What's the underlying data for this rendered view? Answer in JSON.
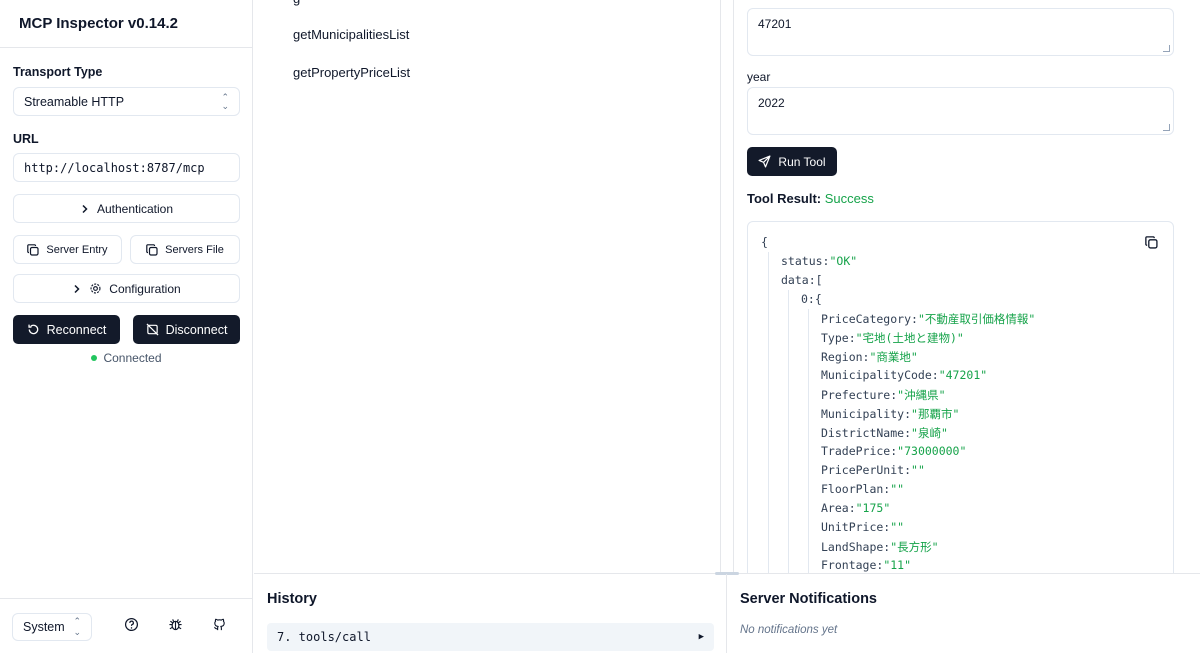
{
  "app": {
    "title": "MCP Inspector v0.14.2"
  },
  "sidebar": {
    "transport_label": "Transport Type",
    "transport_value": "Streamable HTTP",
    "url_label": "URL",
    "url_value": "http://localhost:8787/mcp",
    "authentication_label": "Authentication",
    "server_entry_label": "Server Entry",
    "servers_file_label": "Servers File",
    "configuration_label": "Configuration",
    "reconnect_label": "Reconnect",
    "disconnect_label": "Disconnect",
    "status_text": "Connected",
    "status_color": "#22c55e",
    "theme_value": "System"
  },
  "tools": {
    "items": [
      "getMunicipalitiesList",
      "getPropertyPriceList"
    ]
  },
  "detail": {
    "param1_value": "47201",
    "param2_label": "year",
    "param2_value": "2022",
    "run_label": "Run Tool",
    "result_label": "Tool Result:",
    "result_status": "Success",
    "json": {
      "open_brace": "{",
      "status_key": "status:",
      "status_val": "\"OK\"",
      "data_key": "data:",
      "data_bracket": "[",
      "item_key": "0:",
      "item_brace": "{",
      "fields": [
        {
          "key": "PriceCategory:",
          "val": "\"不動産取引価格情報\""
        },
        {
          "key": "Type:",
          "val": "\"宅地(土地と建物)\""
        },
        {
          "key": "Region:",
          "val": "\"商業地\""
        },
        {
          "key": "MunicipalityCode:",
          "val": "\"47201\""
        },
        {
          "key": "Prefecture:",
          "val": "\"沖縄県\""
        },
        {
          "key": "Municipality:",
          "val": "\"那覇市\""
        },
        {
          "key": "DistrictName:",
          "val": "\"泉崎\""
        },
        {
          "key": "TradePrice:",
          "val": "\"73000000\""
        },
        {
          "key": "PricePerUnit:",
          "val": "\"\""
        },
        {
          "key": "FloorPlan:",
          "val": "\"\""
        },
        {
          "key": "Area:",
          "val": "\"175\""
        },
        {
          "key": "UnitPrice:",
          "val": "\"\""
        },
        {
          "key": "LandShape:",
          "val": "\"長方形\""
        },
        {
          "key": "Frontage:",
          "val": "\"11\""
        }
      ]
    }
  },
  "history": {
    "title": "History",
    "items": [
      "7. tools/call"
    ]
  },
  "notifications": {
    "title": "Server Notifications",
    "empty_text": "No notifications yet"
  }
}
